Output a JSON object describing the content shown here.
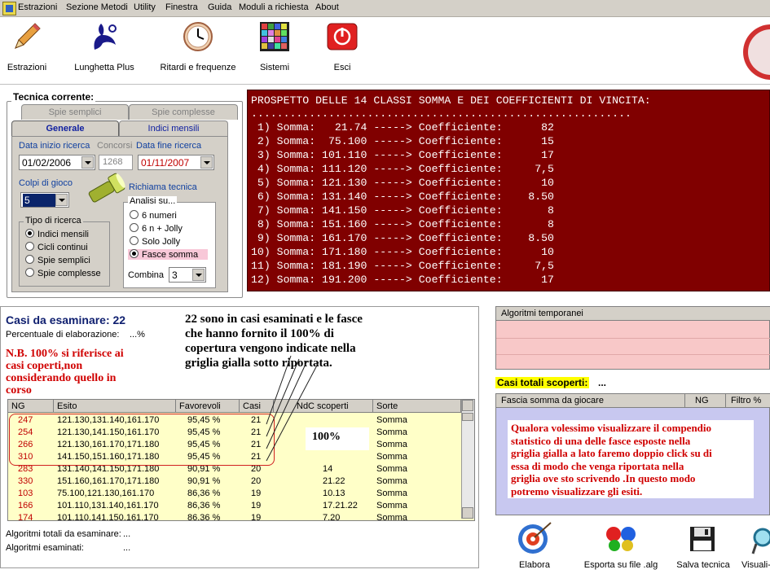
{
  "menu": [
    "Estrazioni",
    "Sezione Metodi",
    "Utility",
    "Finestra",
    "Guida",
    "Moduli a richiesta",
    "About"
  ],
  "toolbar": {
    "buttons": [
      "Estrazioni",
      "Lunghetta Plus",
      "Ritardi e frequenze",
      "Sistemi",
      "Esci"
    ]
  },
  "tecnica": {
    "title": "Tecnica corrente:",
    "tabs_back": [
      "Spie semplici",
      "Spie complesse"
    ],
    "tabs_front": [
      "Generale",
      "Indici mensili"
    ],
    "data_inizio_label": "Data inizio ricerca",
    "data_inizio": "01/02/2006",
    "concorsi_label": "Concorsi",
    "concorsi": "1268",
    "data_fine_label": "Data fine ricerca",
    "data_fine": "01/11/2007",
    "colpi_label": "Colpi di gioco",
    "colpi": "5",
    "richiama_label": "Richiama tecnica",
    "tipo_title": "Tipo di ricerca",
    "tipo_options": [
      "Indici mensili",
      "Cicli continui",
      "Spie semplici",
      "Spie complesse"
    ],
    "tipo_selected": 0,
    "analisi_title": "Analisi su...",
    "analisi_options": [
      "6 numeri",
      "6 n + Jolly",
      "Solo Jolly",
      "Fasce somma"
    ],
    "analisi_selected": 3,
    "combina_label": "Combina",
    "combina": "3"
  },
  "prospetto": {
    "header": "PROSPETTO DELLE 14 CLASSI SOMMA E DEI COEFFICIENTI DI VINCITA:",
    "dots": "...........................................................",
    "lines": [
      " 1) Somma:   21.74 -----> Coefficiente:      82",
      " 2) Somma:  75.100 -----> Coefficiente:      15",
      " 3) Somma: 101.110 -----> Coefficiente:      17",
      " 4) Somma: 111.120 -----> Coefficiente:     7,5",
      " 5) Somma: 121.130 -----> Coefficiente:      10",
      " 6) Somma: 131.140 -----> Coefficiente:    8.50",
      " 7) Somma: 141.150 -----> Coefficiente:       8",
      " 8) Somma: 151.160 -----> Coefficiente:       8",
      " 9) Somma: 161.170 -----> Coefficiente:    8.50",
      "10) Somma: 171.180 -----> Coefficiente:      10",
      "11) Somma: 181.190 -----> Coefficiente:     7,5",
      "12) Somma: 191.200 -----> Coefficiente:      17"
    ]
  },
  "casi": {
    "title": "Casi da esaminare: 22",
    "perc_label": "Percentuale di elaborazione:",
    "perc_value": "...%",
    "note": [
      "N.B. 100% si riferisce ai",
      "casi coperti,non",
      "considerando quello in",
      "corso"
    ],
    "annotation": [
      "22 sono in casi esaminati e le fasce",
      "che hanno fornito il 100% di",
      "copertura vengono indicate nella",
      "griglia gialla sotto riportata."
    ],
    "columns": [
      "NG",
      "Esito",
      "Favorevoli",
      "Casi",
      "NdC scoperti",
      "Sorte"
    ],
    "rows": [
      [
        "247",
        "121.130,131.140,161.170",
        "95,45 %",
        "21",
        "",
        "Somma"
      ],
      [
        "254",
        "121.130,141.150,161.170",
        "95,45 %",
        "21",
        "",
        "Somma"
      ],
      [
        "266",
        "121.130,161.170,171.180",
        "95,45 %",
        "21",
        "",
        "Somma"
      ],
      [
        "310",
        "141.150,151.160,171.180",
        "95,45 %",
        "21",
        "",
        "Somma"
      ],
      [
        "283",
        "131.140,141.150,171.180",
        "90,91 %",
        "20",
        "14",
        "Somma"
      ],
      [
        "330",
        "151.160,161.170,171.180",
        "90,91 %",
        "20",
        "21.22",
        "Somma"
      ],
      [
        "103",
        "75.100,121.130,161.170",
        "86,36 %",
        "19",
        "10.13",
        "Somma"
      ],
      [
        "166",
        "101.110,131.140,161.170",
        "86,36 %",
        "19",
        "17.21.22",
        "Somma"
      ],
      [
        "174",
        "101.110,141.150,161.170",
        "86,36 %",
        "19",
        "7.20",
        "Somma"
      ]
    ],
    "percent_box": "100%",
    "alg_totali_label": "Algoritmi totali da esaminare:",
    "alg_totali": "...",
    "alg_esaminati_label": "Algoritmi esaminati:",
    "alg_esaminati": "..."
  },
  "right": {
    "alg_temp_header": "Algoritmi temporanei",
    "casi_totali": "Casi totali scoperti:",
    "casi_totali_val": "...",
    "fascia_columns": [
      "Fascia somma da giocare",
      "NG",
      "Filtro %"
    ],
    "note": [
      "Qualora volessimo visualizzare il compendio",
      "statistico di una delle fasce esposte nella",
      "griglia gialla a lato faremo doppio click su di",
      "essa di modo che venga riportata nella",
      "griglia ove sto scrivendo .In questo modo",
      "potremo visualizzare gli esiti."
    ]
  },
  "bottom_buttons": [
    "Elabora",
    "Esporta su file .alg",
    "Salva tecnica",
    "Visuali-"
  ]
}
